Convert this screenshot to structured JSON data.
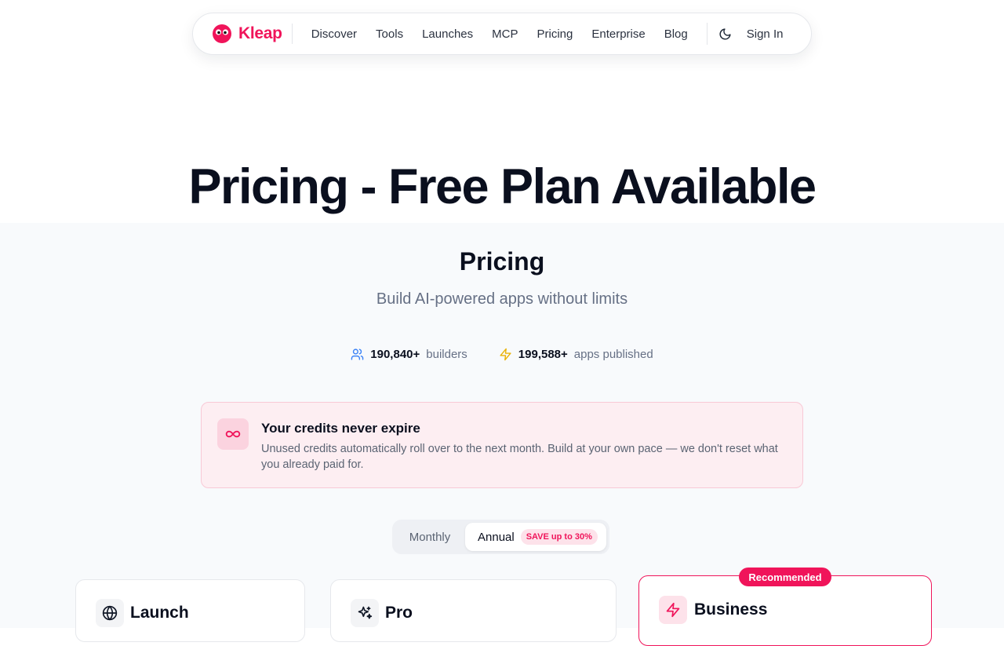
{
  "nav": {
    "logo_text": "Kleap",
    "links": [
      "Discover",
      "Tools",
      "Launches",
      "MCP",
      "Pricing",
      "Enterprise",
      "Blog"
    ],
    "sign_in": "Sign In"
  },
  "hero": {
    "title": "Pricing - Free Plan Available"
  },
  "pricing": {
    "title": "Pricing",
    "subtitle": "Build AI-powered apps without limits",
    "stats": [
      {
        "value": "190,840+",
        "label": "builders",
        "icon": "users-icon"
      },
      {
        "value": "199,588+",
        "label": "apps published",
        "icon": "zap-icon"
      }
    ],
    "credits": {
      "title": "Your credits never expire",
      "text": "Unused credits automatically roll over to the next month. Build at your own pace — we don't reset what you already paid for."
    },
    "billing_toggle": {
      "monthly": "Monthly",
      "annual": "Annual",
      "save_badge": "SAVE up to 30%",
      "selected": "Annual"
    },
    "plans": [
      {
        "name": "Launch",
        "icon": "globe-icon"
      },
      {
        "name": "Pro",
        "icon": "sparkles-icon"
      },
      {
        "name": "Business",
        "icon": "zap-icon",
        "badge": "Recommended"
      }
    ]
  },
  "colors": {
    "brand": "#f0145a",
    "section_bg": "#f8fafc"
  }
}
